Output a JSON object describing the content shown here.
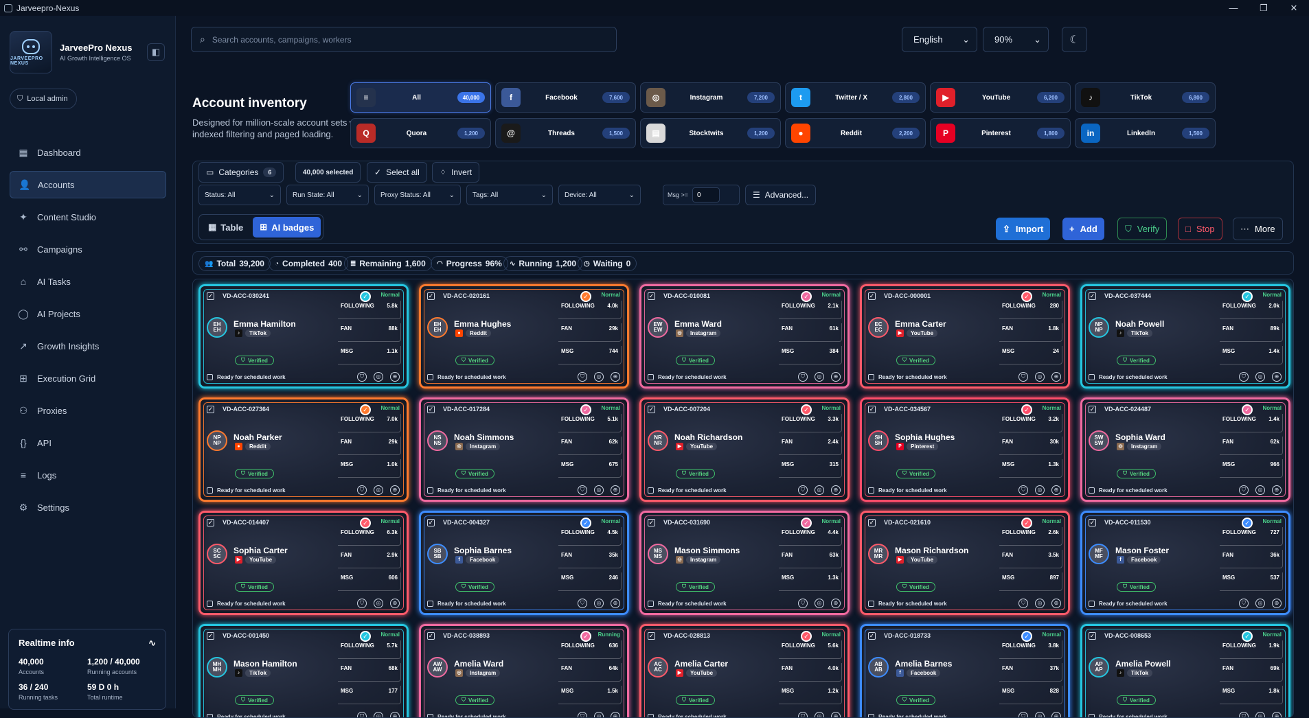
{
  "window": {
    "title": "Jarveepro-Nexus"
  },
  "brand": {
    "name": "JarveePro Nexus",
    "subtitle": "AI Growth Intelligence OS",
    "logo_text": "JARVEEPRO NEXUS"
  },
  "admin_label": "Local admin",
  "nav": [
    {
      "label": "Dashboard",
      "icon": "dashboard-icon",
      "active": false
    },
    {
      "label": "Accounts",
      "icon": "users-icon",
      "active": true
    },
    {
      "label": "Content Studio",
      "icon": "sparkle-icon",
      "active": false
    },
    {
      "label": "Campaigns",
      "icon": "campaigns-icon",
      "active": false
    },
    {
      "label": "AI Tasks",
      "icon": "bot-icon",
      "active": false
    },
    {
      "label": "AI Projects",
      "icon": "chat-icon",
      "active": false
    },
    {
      "label": "Growth Insights",
      "icon": "chart-icon",
      "active": false
    },
    {
      "label": "Execution Grid",
      "icon": "grid-icon",
      "active": false
    },
    {
      "label": "Proxies",
      "icon": "network-icon",
      "active": false
    },
    {
      "label": "API",
      "icon": "braces-icon",
      "active": false
    },
    {
      "label": "Logs",
      "icon": "list-icon",
      "active": false
    },
    {
      "label": "Settings",
      "icon": "gear-icon",
      "active": false
    }
  ],
  "realtime": {
    "title": "Realtime info",
    "stats": [
      {
        "value": "40,000",
        "label": "Accounts"
      },
      {
        "value": "1,200 / 40,000",
        "label": "Running accounts"
      },
      {
        "value": "36 / 240",
        "label": "Running tasks"
      },
      {
        "value": "59 D 0 h",
        "label": "Total runtime"
      }
    ]
  },
  "search": {
    "placeholder": "Search accounts, campaigns, workers"
  },
  "language": "English",
  "zoom": "90%",
  "inventory": {
    "title": "Account inventory",
    "subtitle": "Designed for million-scale account sets with indexed filtering and paged loading."
  },
  "platforms": [
    {
      "name": "All",
      "count": "40,000",
      "color": "#24324d",
      "glyph": "≡",
      "active": true
    },
    {
      "name": "Facebook",
      "count": "7,600",
      "color": "#3b5998",
      "glyph": "f"
    },
    {
      "name": "Instagram",
      "count": "7,200",
      "color": "#6b5a4a",
      "glyph": "◎"
    },
    {
      "name": "Twitter / X",
      "count": "2,800",
      "color": "#1d9bf0",
      "glyph": "t"
    },
    {
      "name": "YouTube",
      "count": "6,200",
      "color": "#e0202a",
      "glyph": "▶"
    },
    {
      "name": "TikTok",
      "count": "6,800",
      "color": "#111111",
      "glyph": "♪"
    },
    {
      "name": "Quora",
      "count": "1,200",
      "color": "#b92b27",
      "glyph": "Q"
    },
    {
      "name": "Threads",
      "count": "1,500",
      "color": "#1a1a1a",
      "glyph": "@"
    },
    {
      "name": "Stocktwits",
      "count": "1,200",
      "color": "#d9d9d9",
      "glyph": "▤"
    },
    {
      "name": "Reddit",
      "count": "2,200",
      "color": "#ff4500",
      "glyph": "●"
    },
    {
      "name": "Pinterest",
      "count": "1,800",
      "color": "#e60023",
      "glyph": "P"
    },
    {
      "name": "LinkedIn",
      "count": "1,500",
      "color": "#0a66c2",
      "glyph": "in"
    }
  ],
  "toolbar": {
    "categories_label": "Categories",
    "categories_count": "6",
    "selected_label": "40,000 selected",
    "select_all": "Select all",
    "invert": "Invert",
    "filters": [
      "Status: All",
      "Run State: All",
      "Proxy Status: All",
      "Tags: All",
      "Device: All"
    ],
    "msg_label": "Msg >=",
    "msg_value": "0",
    "advanced": "Advanced...",
    "view_table": "Table",
    "view_badges": "AI badges",
    "import": "Import",
    "add": "Add",
    "verify": "Verify",
    "stop": "Stop",
    "more": "More"
  },
  "stats": [
    {
      "label": "Total",
      "value": "39,200"
    },
    {
      "label": "Completed",
      "value": "400"
    },
    {
      "label": "Remaining",
      "value": "1,600"
    },
    {
      "label": "Progress",
      "value": "96%"
    },
    {
      "label": "Running",
      "value": "1,200"
    },
    {
      "label": "Waiting",
      "value": "0"
    }
  ],
  "card_labels": {
    "following": "FOLLOWING",
    "fan": "FAN",
    "msg": "MSG",
    "verified": "Verified",
    "ready": "Ready for scheduled work"
  },
  "cards": [
    {
      "id": "VD-ACC-030241",
      "name": "Emma Hamilton",
      "initials": "EH",
      "platform": "TikTok",
      "status": "Normal",
      "following": "5.8k",
      "fan": "88k",
      "msg": "1.1k",
      "color": "#25c6e0"
    },
    {
      "id": "VD-ACC-020161",
      "name": "Emma Hughes",
      "initials": "EH",
      "platform": "Reddit",
      "status": "Normal",
      "following": "4.0k",
      "fan": "29k",
      "msg": "744",
      "color": "#ff7a2e"
    },
    {
      "id": "VD-ACC-010081",
      "name": "Emma Ward",
      "initials": "EW",
      "platform": "Instagram",
      "status": "Normal",
      "following": "2.1k",
      "fan": "61k",
      "msg": "384",
      "color": "#f06aa0"
    },
    {
      "id": "VD-ACC-000001",
      "name": "Emma Carter",
      "initials": "EC",
      "platform": "YouTube",
      "status": "Normal",
      "following": "280",
      "fan": "1.8k",
      "msg": "24",
      "color": "#ff5a6a"
    },
    {
      "id": "VD-ACC-037444",
      "name": "Noah Powell",
      "initials": "NP",
      "platform": "TikTok",
      "status": "Normal",
      "following": "2.0k",
      "fan": "89k",
      "msg": "1.4k",
      "color": "#25c6e0"
    },
    {
      "id": "VD-ACC-027364",
      "name": "Noah Parker",
      "initials": "NP",
      "platform": "Reddit",
      "status": "Normal",
      "following": "7.0k",
      "fan": "29k",
      "msg": "1.0k",
      "color": "#ff7a2e"
    },
    {
      "id": "VD-ACC-017284",
      "name": "Noah Simmons",
      "initials": "NS",
      "platform": "Instagram",
      "status": "Normal",
      "following": "5.1k",
      "fan": "62k",
      "msg": "675",
      "color": "#f06aa0"
    },
    {
      "id": "VD-ACC-007204",
      "name": "Noah Richardson",
      "initials": "NR",
      "platform": "YouTube",
      "status": "Normal",
      "following": "3.3k",
      "fan": "2.4k",
      "msg": "315",
      "color": "#ff5a6a"
    },
    {
      "id": "VD-ACC-034567",
      "name": "Sophia Hughes",
      "initials": "SH",
      "platform": "Pinterest",
      "status": "Normal",
      "following": "3.2k",
      "fan": "30k",
      "msg": "1.3k",
      "color": "#ff4d6a"
    },
    {
      "id": "VD-ACC-024487",
      "name": "Sophia Ward",
      "initials": "SW",
      "platform": "Instagram",
      "status": "Normal",
      "following": "1.4k",
      "fan": "62k",
      "msg": "966",
      "color": "#f06aa0"
    },
    {
      "id": "VD-ACC-014407",
      "name": "Sophia Carter",
      "initials": "SC",
      "platform": "YouTube",
      "status": "Normal",
      "following": "6.3k",
      "fan": "2.9k",
      "msg": "606",
      "color": "#ff5a6a"
    },
    {
      "id": "VD-ACC-004327",
      "name": "Sophia Barnes",
      "initials": "SB",
      "platform": "Facebook",
      "status": "Normal",
      "following": "4.5k",
      "fan": "35k",
      "msg": "246",
      "color": "#3d8cff"
    },
    {
      "id": "VD-ACC-031690",
      "name": "Mason Simmons",
      "initials": "MS",
      "platform": "Instagram",
      "status": "Normal",
      "following": "4.4k",
      "fan": "63k",
      "msg": "1.3k",
      "color": "#f06aa0"
    },
    {
      "id": "VD-ACC-021610",
      "name": "Mason Richardson",
      "initials": "MR",
      "platform": "YouTube",
      "status": "Normal",
      "following": "2.6k",
      "fan": "3.5k",
      "msg": "897",
      "color": "#ff5a6a"
    },
    {
      "id": "VD-ACC-011530",
      "name": "Mason Foster",
      "initials": "MF",
      "platform": "Facebook",
      "status": "Normal",
      "following": "727",
      "fan": "36k",
      "msg": "537",
      "color": "#3d8cff"
    },
    {
      "id": "VD-ACC-001450",
      "name": "Mason Hamilton",
      "initials": "MH",
      "platform": "TikTok",
      "status": "Normal",
      "following": "5.7k",
      "fan": "68k",
      "msg": "177",
      "color": "#25c6e0"
    },
    {
      "id": "VD-ACC-038893",
      "name": "Amelia Ward",
      "initials": "AW",
      "platform": "Instagram",
      "status": "Running",
      "following": "636",
      "fan": "64k",
      "msg": "1.5k",
      "color": "#f06aa0"
    },
    {
      "id": "VD-ACC-028813",
      "name": "Amelia Carter",
      "initials": "AC",
      "platform": "YouTube",
      "status": "Normal",
      "following": "5.6k",
      "fan": "4.0k",
      "msg": "1.2k",
      "color": "#ff5a6a"
    },
    {
      "id": "VD-ACC-018733",
      "name": "Amelia Barnes",
      "initials": "AB",
      "platform": "Facebook",
      "status": "Normal",
      "following": "3.8k",
      "fan": "37k",
      "msg": "828",
      "color": "#3d8cff"
    },
    {
      "id": "VD-ACC-008653",
      "name": "Amelia Powell",
      "initials": "AP",
      "platform": "TikTok",
      "status": "Normal",
      "following": "1.9k",
      "fan": "69k",
      "msg": "1.8k",
      "color": "#25c6e0"
    }
  ],
  "platform_colors": {
    "TikTok": "#111111",
    "Reddit": "#ff4500",
    "Instagram": "#8a6a50",
    "YouTube": "#e0202a",
    "Pinterest": "#e60023",
    "Facebook": "#3b5998"
  }
}
